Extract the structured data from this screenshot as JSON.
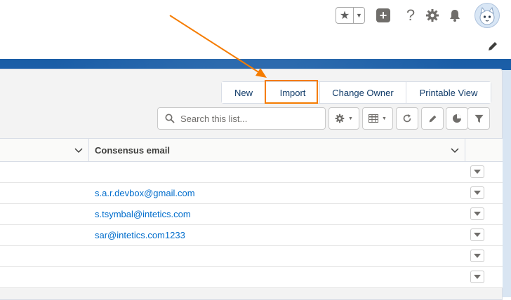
{
  "header": {
    "icons": [
      "star-icon",
      "chevron-down-icon",
      "plus-icon",
      "help-icon",
      "gear-icon",
      "bell-icon",
      "avatar",
      "pencil-icon"
    ]
  },
  "actions": {
    "new_label": "New",
    "import_label": "Import",
    "change_owner_label": "Change Owner",
    "printable_view_label": "Printable View"
  },
  "search": {
    "placeholder": "Search this list..."
  },
  "toolbar": {
    "icons": [
      "gear-icon",
      "table-icon",
      "refresh-icon",
      "pencil-icon",
      "pie-chart-icon",
      "filter-icon"
    ]
  },
  "table": {
    "column_header": "Consensus email",
    "rows": [
      {
        "email": ""
      },
      {
        "email": "s.a.r.devbox@gmail.com"
      },
      {
        "email": "s.tsymbal@intetics.com"
      },
      {
        "email": "sar@intetics.com1233"
      },
      {
        "email": ""
      },
      {
        "email": ""
      }
    ]
  },
  "colors": {
    "accent": "#f57c00",
    "brand_blue": "#1b5ea6",
    "link": "#006dcc"
  }
}
